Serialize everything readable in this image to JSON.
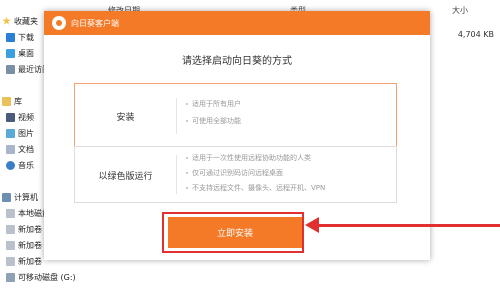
{
  "explorer": {
    "columns": [
      "修改日期",
      "类型",
      "大小"
    ],
    "file_row": {
      "size": "4,704 KB"
    },
    "nav": [
      {
        "label": "收藏夹",
        "icon": "star-icon"
      },
      {
        "label": "下载",
        "icon": "download-folder-icon"
      },
      {
        "label": "桌面",
        "icon": "desktop-folder-icon"
      },
      {
        "label": "最近访问的位置",
        "icon": "recent-places-icon"
      },
      {
        "label": "库",
        "icon": "library-icon"
      },
      {
        "label": "视频",
        "icon": "video-library-icon"
      },
      {
        "label": "图片",
        "icon": "pictures-library-icon"
      },
      {
        "label": "文档",
        "icon": "documents-library-icon"
      },
      {
        "label": "音乐",
        "icon": "music-library-icon"
      },
      {
        "label": "计算机",
        "icon": "computer-icon"
      },
      {
        "label": "本地磁盘",
        "icon": "local-disk-icon"
      },
      {
        "label": "新加卷",
        "icon": "disk-drive-icon"
      },
      {
        "label": "新加卷",
        "icon": "disk-drive-icon"
      },
      {
        "label": "新加卷",
        "icon": "disk-drive-icon"
      },
      {
        "label": "可移动磁盘 (G:)",
        "icon": "removable-disk-icon"
      }
    ]
  },
  "dialog": {
    "title": "向日葵客户端",
    "heading": "请选择启动向日葵的方式",
    "options": [
      {
        "label": "安装",
        "features": [
          "适用于所有用户",
          "可使用全部功能"
        ],
        "selected": true
      },
      {
        "label": "以绿色版运行",
        "features": [
          "适用于一次性使用远程协助功能的人类",
          "仅可通过识别码访问远程桌面",
          "不支持远程文件、摄像头、远程开机、VPN"
        ],
        "selected": false
      }
    ],
    "start_button": "立即安装"
  },
  "colors": {
    "brand_orange": "#f47a28",
    "annotation_red": "#e03030"
  }
}
